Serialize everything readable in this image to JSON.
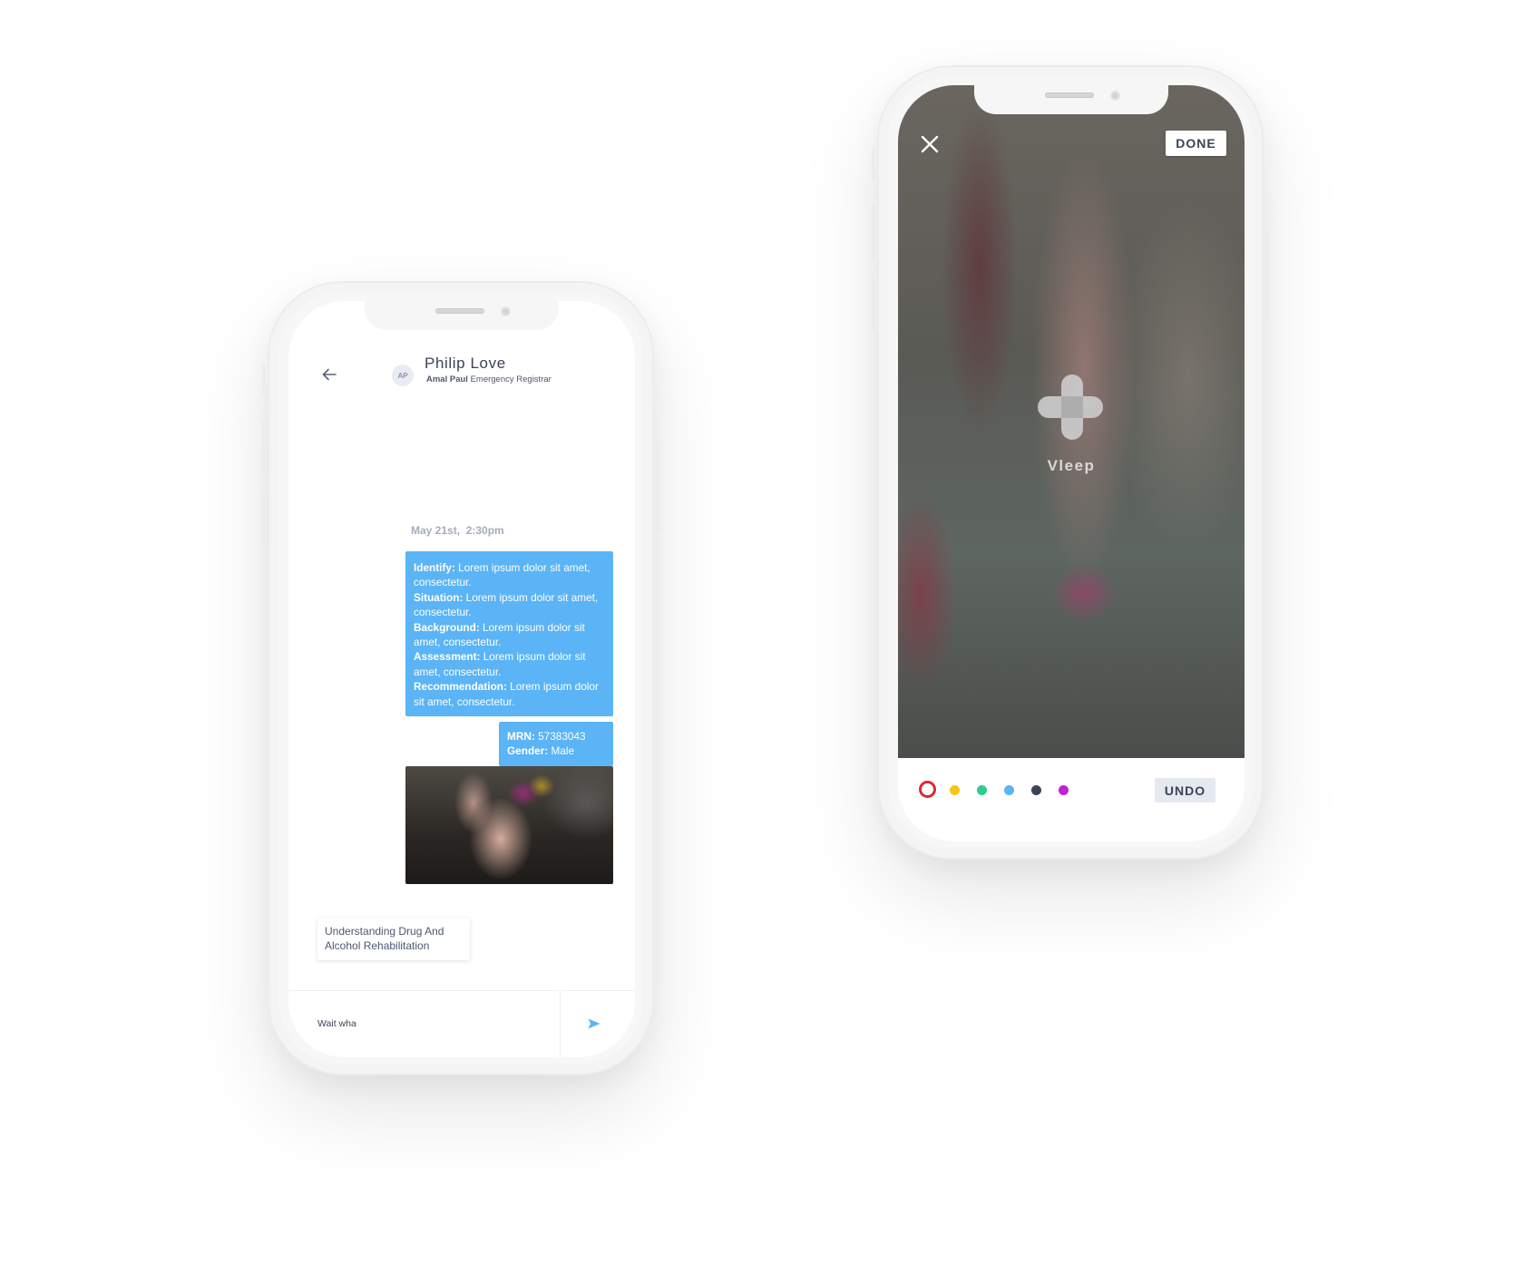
{
  "chat_screen": {
    "header": {
      "avatar_initials": "AP",
      "contact_name": "Philip Love",
      "sender_name": "Amal Paul",
      "sender_role": "Emergency Registrar"
    },
    "timestamp": "May 21st,  2:30pm",
    "sbar_message": {
      "rows": [
        {
          "label": "Identify:",
          "text": " Lorem ipsum dolor sit amet, consectetur."
        },
        {
          "label": "Situation:",
          "text": " Lorem ipsum dolor sit amet, consectetur."
        },
        {
          "label": "Background:",
          "text": " Lorem ipsum dolor sit amet, consectetur."
        },
        {
          "label": "Assessment:",
          "text": " Lorem ipsum dolor sit amet, consectetur."
        },
        {
          "label": "Recommendation:",
          "text": " Lorem ipsum dolor sit amet, consectetur."
        }
      ]
    },
    "patient_message": {
      "mrn_label": "MRN:",
      "mrn_value": " 57383043",
      "gender_label": "Gender:",
      "gender_value": " Male"
    },
    "article_card": {
      "title": "Understanding Drug And Alcohol Rehabilitation"
    },
    "composer": {
      "value": "Wait wha"
    },
    "icons": {
      "back": "arrow-left-icon",
      "send": "send-icon"
    },
    "colors": {
      "bubble": "#5ab4f6",
      "text_dark": "#3b4357"
    }
  },
  "markup_screen": {
    "done_label": "DONE",
    "undo_label": "UNDO",
    "logo_word": "Vleep",
    "icons": {
      "close": "close-icon",
      "logo": "vleep-logo-icon"
    },
    "palette": [
      {
        "name": "red",
        "color": "#e0263a",
        "selected": true
      },
      {
        "name": "yellow",
        "color": "#f5c518",
        "selected": false
      },
      {
        "name": "green",
        "color": "#2ecc8a",
        "selected": false
      },
      {
        "name": "blue",
        "color": "#5ab4f6",
        "selected": false
      },
      {
        "name": "navy",
        "color": "#3b4357",
        "selected": false
      },
      {
        "name": "purple",
        "color": "#c21fd8",
        "selected": false
      }
    ]
  }
}
